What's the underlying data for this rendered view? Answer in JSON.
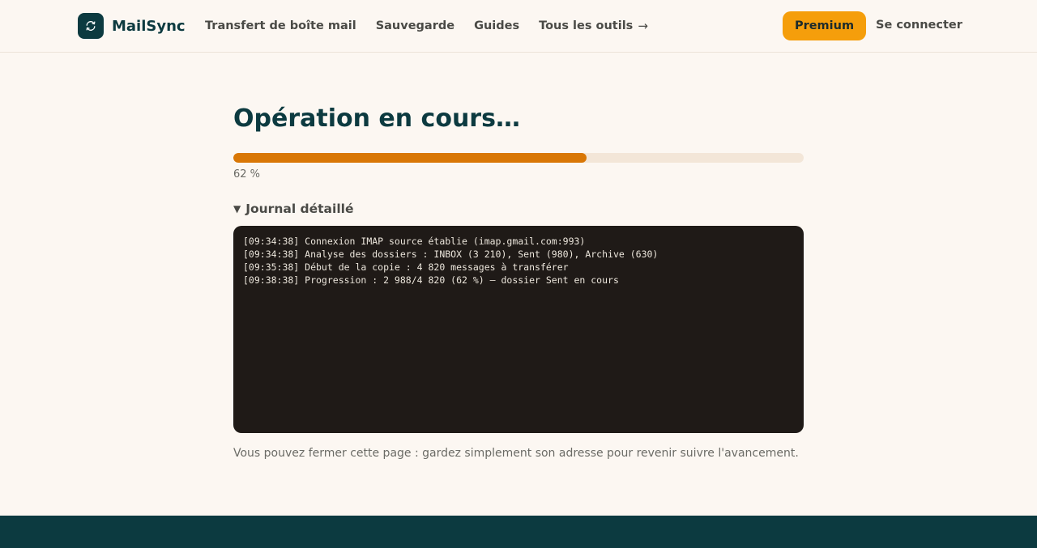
{
  "header": {
    "brand": "MailSync",
    "nav": [
      {
        "label": "Transfert de boîte mail"
      },
      {
        "label": "Sauvegarde"
      },
      {
        "label": "Guides"
      },
      {
        "label": "Tous les outils"
      }
    ],
    "nav_more_arrow": "→",
    "premium_label": "Premium",
    "login_label": "Se connecter"
  },
  "main": {
    "title": "Opération en cours…",
    "progress": {
      "value": 62,
      "label": "62 %"
    },
    "log": {
      "summary": "Journal détaillé",
      "lines": [
        "[09:34:38] Connexion IMAP source établie (imap.gmail.com:993)",
        "[09:34:38] Analyse des dossiers : INBOX (3 210), Sent (980), Archive (630)",
        "[09:35:38] Début de la copie : 4 820 messages à transférer",
        "[09:38:38] Progression : 2 988/4 820 (62 %) — dossier Sent en cours"
      ]
    },
    "note": "Vous pouvez fermer cette page : gardez simplement son adresse pour revenir suivre l'avancement."
  },
  "colors": {
    "brand": "#0c3a40",
    "accent": "#f59e0b",
    "progress": "#d97706",
    "background": "#fcf7f2"
  },
  "icons": {
    "logo": "sync-icon",
    "nav_more": "arrow-right-icon",
    "log_toggle": "triangle-down-icon"
  }
}
